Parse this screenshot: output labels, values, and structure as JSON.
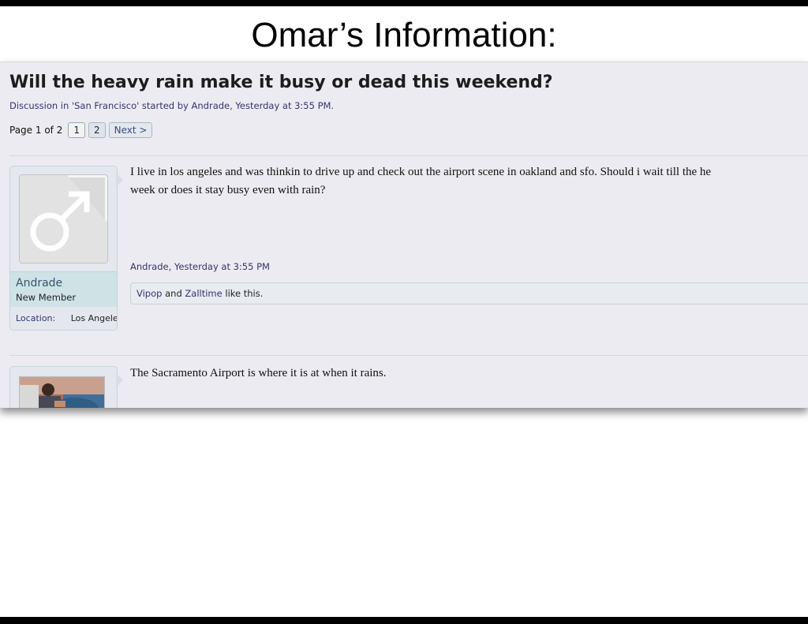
{
  "slide": {
    "title": "Omar’s Information:"
  },
  "thread": {
    "title": "Will the heavy rain make it busy or dead this weekend?",
    "meta": "Discussion in 'San Francisco' started by Andrade, Yesterday at 3:55 PM."
  },
  "pager": {
    "label": "Page 1 of 2",
    "pages": [
      "1",
      "2"
    ],
    "next": "Next >"
  },
  "posts": [
    {
      "username": "Andrade",
      "user_title": "New Member",
      "location_label": "Location:",
      "location_value": "Los Angeles",
      "message_line1": "I live in los angeles and was thinkin to drive up and check out the airport scene in oakland and sfo. Should i wait till the he",
      "message_line2": "week or does it stay busy even with rain?",
      "post_meta": "Andrade, Yesterday at 3:55 PM",
      "likes": {
        "user1": "Vipop",
        "and": "and",
        "user2": "Zalltime",
        "suffix": "like this."
      }
    },
    {
      "message_line1": "The Sacramento Airport is where it is at when it rains."
    }
  ],
  "colors": {
    "link": "#34346e",
    "background": "#ecebf1",
    "username_panel": "#cfe2e6"
  }
}
